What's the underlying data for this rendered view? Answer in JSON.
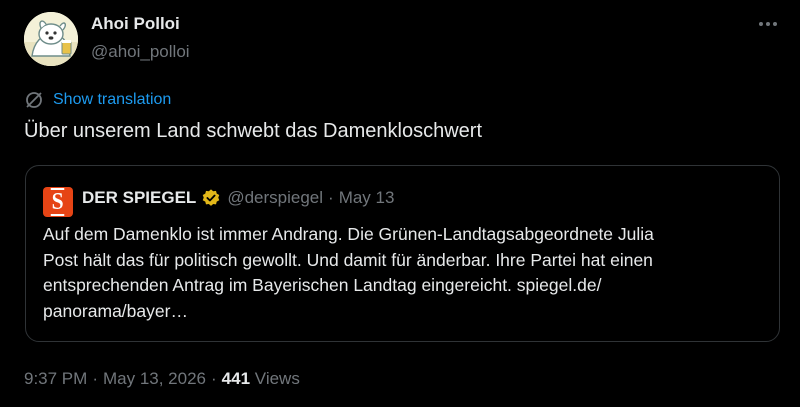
{
  "author": {
    "display_name": "Ahoi Polloi",
    "handle": "@ahoi_polloi",
    "avatar_icon": "cartoon-dog-avatar"
  },
  "actions": {
    "more_icon": "more-horizontal-icon",
    "translate_icon": "globe-slash-icon",
    "show_translation": "Show translation"
  },
  "tweet": {
    "text": "Über unserem Land schwebt das Damenkloschwert"
  },
  "quote": {
    "logo_letter": "S",
    "logo_color": "#e64415",
    "name": "DER SPIEGEL",
    "verified_icon": "gold-verified-badge-icon",
    "verified_color": "#e2b719",
    "handle": "@derspiegel",
    "separator": "·",
    "date": "May 13",
    "body_lines": [
      "Auf dem Damenklo ist immer Andrang. Die Grünen-Landtagsabgeordnete Julia",
      "Post hält das für politisch gewollt. Und damit für änderbar. Ihre Partei hat einen",
      "entsprechenden Antrag im Bayerischen Landtag eingereicht. spiegel.de/",
      "panorama/bayer…"
    ]
  },
  "meta": {
    "time": "9:37 PM",
    "separator": "·",
    "date": "May 13, 2026",
    "views_count": "441",
    "views_label": "Views"
  },
  "colors": {
    "background": "#000000",
    "primary_text": "#e7e9ea",
    "secondary_text": "#71767b",
    "link": "#1d9bf0",
    "border": "#2f3336"
  }
}
